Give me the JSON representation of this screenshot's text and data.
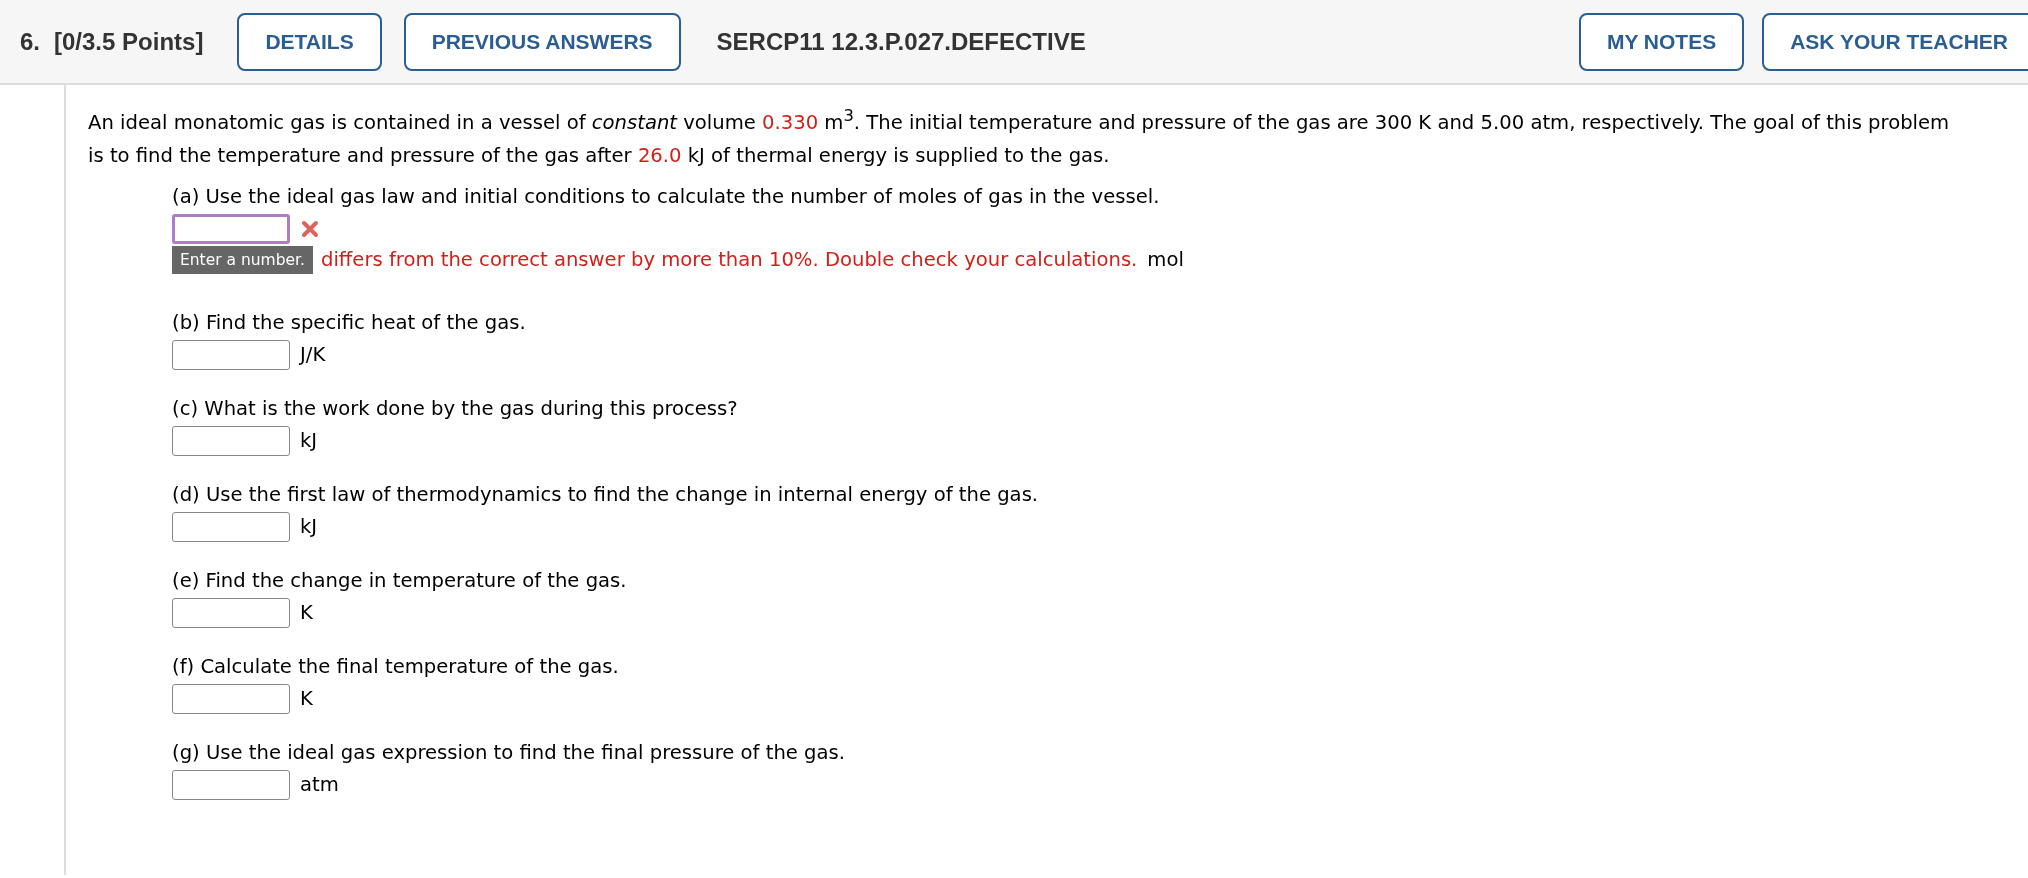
{
  "header": {
    "number": "6.",
    "points": "[0/3.5 Points]",
    "left_buttons": [
      "DETAILS",
      "PREVIOUS ANSWERS"
    ],
    "code": "SERCP11 12.3.P.027.DEFECTIVE",
    "right_buttons": [
      "MY NOTES",
      "ASK YOUR TEACHER"
    ]
  },
  "intro": [
    {
      "kind": "text",
      "text": "An ideal monatomic gas is contained in a vessel of *constant* volume "
    },
    {
      "kind": "given",
      "text": "0.330"
    },
    {
      "kind": "text",
      "text": " m$^{3}$. The initial temperature and pressure of the gas are 300 K and 5.00 atm, respectively. The goal of this problem is to find the temperature and pressure of the gas after "
    },
    {
      "kind": "given",
      "text": "26.0"
    },
    {
      "kind": "text",
      "text": " kJ of thermal energy is supplied to the gas."
    }
  ],
  "parts": [
    {
      "question": "(a) Use the ideal gas law and initial conditions to calculate the number of moles of gas in the vessel.",
      "incorrect": true,
      "hint": "Enter a number.",
      "feedback": "differs from the correct answer by more than 10%. Double check your calculations.",
      "unit": "mol"
    },
    {
      "question": "(b) Find the specific heat of the gas.",
      "incorrect": false,
      "unit": "J/K"
    },
    {
      "question": "(c) What is the work done by the gas during this process?",
      "incorrect": false,
      "unit": "kJ"
    },
    {
      "question": "(d) Use the first law of thermodynamics to find the change in internal energy of the gas.",
      "incorrect": false,
      "unit": "kJ"
    },
    {
      "question": "(e) Find the change in temperature of the gas.",
      "incorrect": false,
      "unit": "K"
    },
    {
      "question": "(f) Calculate the final temperature of the gas.",
      "incorrect": false,
      "unit": "K"
    },
    {
      "question": "(g) Use the ideal gas expression to find the final pressure of the gas.",
      "incorrect": false,
      "unit": "atm"
    }
  ]
}
